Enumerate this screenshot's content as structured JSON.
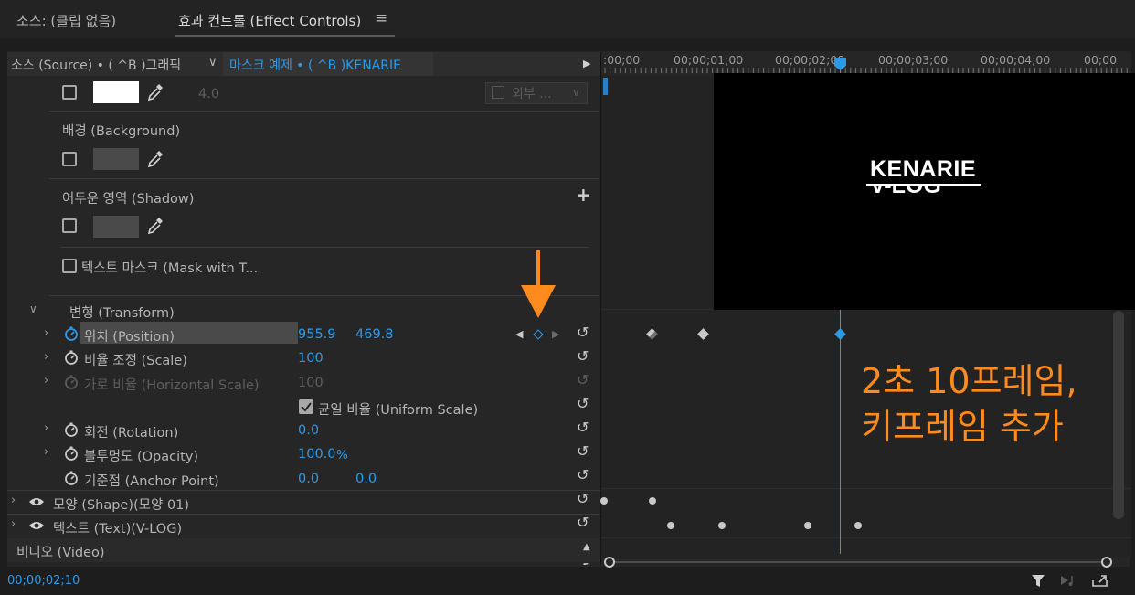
{
  "tabs": {
    "source": "소스: (클립 없음)",
    "effect_controls": "효과 컨트롤 (Effect Controls)",
    "menu_icon": "≡"
  },
  "header": {
    "source_clip": "소스 (Source) • ( ^B )그래픽",
    "chevron": "∨",
    "target_clip": "마스크 예제 • ( ^B )KENARIE",
    "play_icon": "▶"
  },
  "ruler": {
    "timecodes": [
      ":00;00",
      "00;00;01;00",
      "00;00;02;00",
      "00;00;03;00",
      "00;00;04;00",
      "00;00"
    ]
  },
  "effects": {
    "fill_value": "4.0",
    "fill_mode": "외부 ...",
    "background_label": "배경 (Background)",
    "shadow_label": "어두운 영역 (Shadow)",
    "plus": "+",
    "text_mask_label": "텍스트 마스크 (Mask with T...",
    "transform_label": "변형 (Transform)",
    "position_label": "위치 (Position)",
    "position_x": "955.9",
    "position_y": "469.8",
    "scale_label": "비율 조정 (Scale)",
    "scale_value": "100",
    "hscale_label": "가로 비율 (Horizontal Scale)",
    "hscale_value": "100",
    "uniform_label": "균일 비율 (Uniform Scale)",
    "rotation_label": "회전 (Rotation)",
    "rotation_value": "0.0",
    "opacity_label": "불투명도 (Opacity)",
    "opacity_value": "100.0",
    "opacity_unit": "%",
    "anchor_label": "기준점 (Anchor Point)",
    "anchor_x": "0.0",
    "anchor_y": "0.0",
    "shape_label": "모양 (Shape)(모양 01)",
    "text_label": "텍스트 (Text)(V-LOG)",
    "video_label": "비디오 (Video)"
  },
  "preview": {
    "line1": "KENARIE",
    "line2": "V-LOG"
  },
  "annotation": {
    "line1": "2초 10프레임,",
    "line2": "키프레임 추가"
  },
  "footer": {
    "timecode": "00;00;02;10"
  },
  "colors": {
    "accent": "#2d9ae8",
    "annotation": "#ff8a1d",
    "panel": "#262626"
  }
}
